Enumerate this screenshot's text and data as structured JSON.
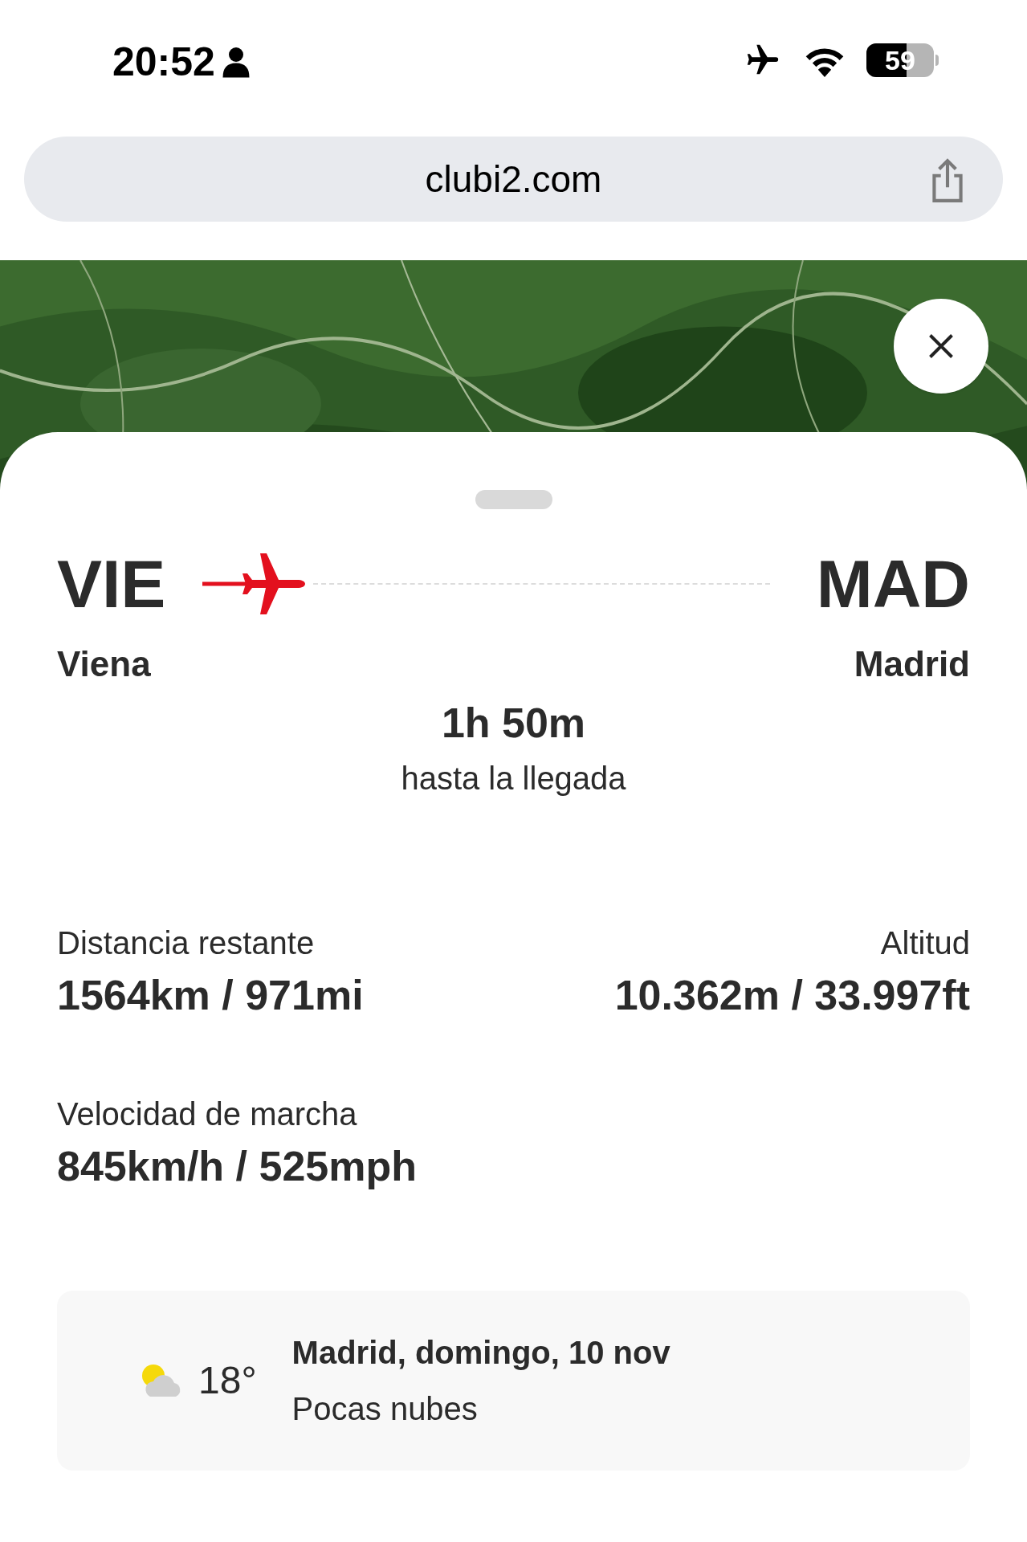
{
  "status_bar": {
    "time": "20:52",
    "battery": "59"
  },
  "browser": {
    "url": "clubi2.com"
  },
  "flight": {
    "origin": {
      "code": "VIE",
      "city": "Viena"
    },
    "destination": {
      "code": "MAD",
      "city": "Madrid"
    },
    "remaining_time": "1h 50m",
    "remaining_caption": "hasta la llegada"
  },
  "stats": [
    {
      "label": "Distancia restante",
      "value": "1564km / 971mi"
    },
    {
      "label": "Altitud",
      "value": "10.362m / 33.997ft"
    },
    {
      "label": "Velocidad de marcha",
      "value": "845km/h / 525mph"
    }
  ],
  "weather": {
    "temperature": "18°",
    "title": "Madrid, domingo, 10 nov",
    "condition": "Pocas nubes"
  }
}
